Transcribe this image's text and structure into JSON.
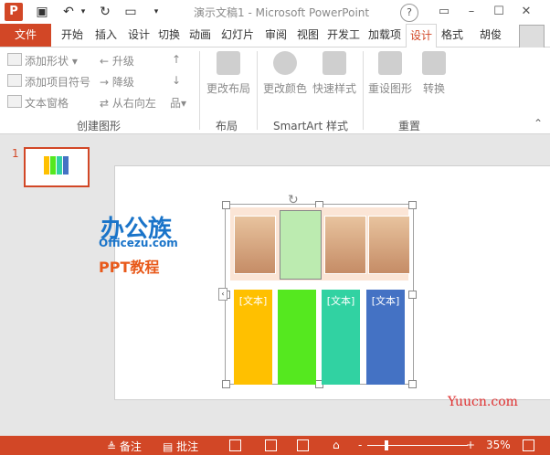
{
  "window": {
    "title": "演示文稿1 - Microsoft PowerPoint",
    "help": "?",
    "user": "胡俊",
    "logo": "P"
  },
  "tabs": [
    "开始",
    "插入",
    "设计",
    "切换",
    "动画",
    "幻灯片",
    "审阅",
    "视图",
    "开发工",
    "加载项",
    "设计",
    "格式"
  ],
  "file_tab": "文件",
  "ribbon": {
    "create": {
      "add_shape": "添加形状",
      "add_bullet": "添加项目符号",
      "text_pane": "文本窗格",
      "promote": "升级",
      "demote": "降级",
      "rtl": "从右向左",
      "label": "创建图形"
    },
    "layout": {
      "change_layout": "更改布局",
      "label": "布局"
    },
    "styles": {
      "change_colors": "更改颜色",
      "quick_styles": "快速样式",
      "label": "SmartArt 样式"
    },
    "reset": {
      "reset_graphic": "重设图形",
      "convert": "转换",
      "label": "重置"
    }
  },
  "slide_panel": {
    "slide_number": "1"
  },
  "slide": {
    "logo_main": "办公族",
    "logo_url": "Officezu.com",
    "logo_sub": "PPT教程",
    "columns": [
      {
        "label": "[文本]",
        "color": "#ffc000"
      },
      {
        "label": "",
        "color": "#55e81f"
      },
      {
        "label": "[文本]",
        "color": "#31d2a2"
      },
      {
        "label": "[文本]",
        "color": "#4472c4"
      }
    ]
  },
  "watermark": "Yuucn.com",
  "status": {
    "notes": "备注",
    "comments": "批注",
    "zoom": "35%",
    "zoom_minus": "-",
    "zoom_plus": "+"
  },
  "colors": {
    "accent": "#d24726"
  }
}
